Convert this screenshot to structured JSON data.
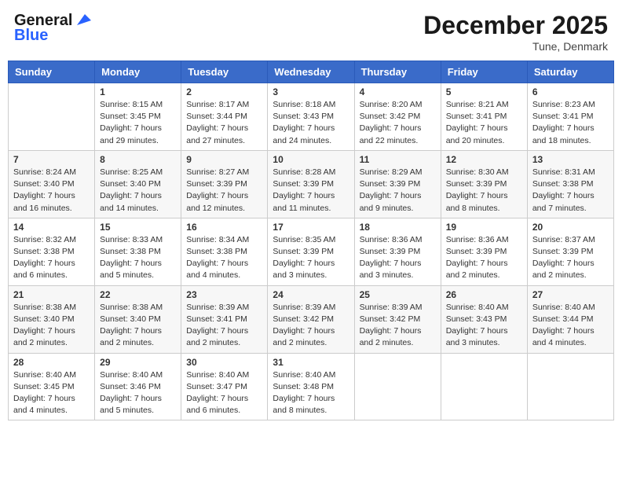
{
  "header": {
    "logo_line1": "General",
    "logo_line2": "Blue",
    "month": "December 2025",
    "location": "Tune, Denmark"
  },
  "days_of_week": [
    "Sunday",
    "Monday",
    "Tuesday",
    "Wednesday",
    "Thursday",
    "Friday",
    "Saturday"
  ],
  "weeks": [
    [
      {
        "day": "",
        "sunrise": "",
        "sunset": "",
        "daylight": ""
      },
      {
        "day": "1",
        "sunrise": "Sunrise: 8:15 AM",
        "sunset": "Sunset: 3:45 PM",
        "daylight": "Daylight: 7 hours and 29 minutes."
      },
      {
        "day": "2",
        "sunrise": "Sunrise: 8:17 AM",
        "sunset": "Sunset: 3:44 PM",
        "daylight": "Daylight: 7 hours and 27 minutes."
      },
      {
        "day": "3",
        "sunrise": "Sunrise: 8:18 AM",
        "sunset": "Sunset: 3:43 PM",
        "daylight": "Daylight: 7 hours and 24 minutes."
      },
      {
        "day": "4",
        "sunrise": "Sunrise: 8:20 AM",
        "sunset": "Sunset: 3:42 PM",
        "daylight": "Daylight: 7 hours and 22 minutes."
      },
      {
        "day": "5",
        "sunrise": "Sunrise: 8:21 AM",
        "sunset": "Sunset: 3:41 PM",
        "daylight": "Daylight: 7 hours and 20 minutes."
      },
      {
        "day": "6",
        "sunrise": "Sunrise: 8:23 AM",
        "sunset": "Sunset: 3:41 PM",
        "daylight": "Daylight: 7 hours and 18 minutes."
      }
    ],
    [
      {
        "day": "7",
        "sunrise": "Sunrise: 8:24 AM",
        "sunset": "Sunset: 3:40 PM",
        "daylight": "Daylight: 7 hours and 16 minutes."
      },
      {
        "day": "8",
        "sunrise": "Sunrise: 8:25 AM",
        "sunset": "Sunset: 3:40 PM",
        "daylight": "Daylight: 7 hours and 14 minutes."
      },
      {
        "day": "9",
        "sunrise": "Sunrise: 8:27 AM",
        "sunset": "Sunset: 3:39 PM",
        "daylight": "Daylight: 7 hours and 12 minutes."
      },
      {
        "day": "10",
        "sunrise": "Sunrise: 8:28 AM",
        "sunset": "Sunset: 3:39 PM",
        "daylight": "Daylight: 7 hours and 11 minutes."
      },
      {
        "day": "11",
        "sunrise": "Sunrise: 8:29 AM",
        "sunset": "Sunset: 3:39 PM",
        "daylight": "Daylight: 7 hours and 9 minutes."
      },
      {
        "day": "12",
        "sunrise": "Sunrise: 8:30 AM",
        "sunset": "Sunset: 3:39 PM",
        "daylight": "Daylight: 7 hours and 8 minutes."
      },
      {
        "day": "13",
        "sunrise": "Sunrise: 8:31 AM",
        "sunset": "Sunset: 3:38 PM",
        "daylight": "Daylight: 7 hours and 7 minutes."
      }
    ],
    [
      {
        "day": "14",
        "sunrise": "Sunrise: 8:32 AM",
        "sunset": "Sunset: 3:38 PM",
        "daylight": "Daylight: 7 hours and 6 minutes."
      },
      {
        "day": "15",
        "sunrise": "Sunrise: 8:33 AM",
        "sunset": "Sunset: 3:38 PM",
        "daylight": "Daylight: 7 hours and 5 minutes."
      },
      {
        "day": "16",
        "sunrise": "Sunrise: 8:34 AM",
        "sunset": "Sunset: 3:38 PM",
        "daylight": "Daylight: 7 hours and 4 minutes."
      },
      {
        "day": "17",
        "sunrise": "Sunrise: 8:35 AM",
        "sunset": "Sunset: 3:39 PM",
        "daylight": "Daylight: 7 hours and 3 minutes."
      },
      {
        "day": "18",
        "sunrise": "Sunrise: 8:36 AM",
        "sunset": "Sunset: 3:39 PM",
        "daylight": "Daylight: 7 hours and 3 minutes."
      },
      {
        "day": "19",
        "sunrise": "Sunrise: 8:36 AM",
        "sunset": "Sunset: 3:39 PM",
        "daylight": "Daylight: 7 hours and 2 minutes."
      },
      {
        "day": "20",
        "sunrise": "Sunrise: 8:37 AM",
        "sunset": "Sunset: 3:39 PM",
        "daylight": "Daylight: 7 hours and 2 minutes."
      }
    ],
    [
      {
        "day": "21",
        "sunrise": "Sunrise: 8:38 AM",
        "sunset": "Sunset: 3:40 PM",
        "daylight": "Daylight: 7 hours and 2 minutes."
      },
      {
        "day": "22",
        "sunrise": "Sunrise: 8:38 AM",
        "sunset": "Sunset: 3:40 PM",
        "daylight": "Daylight: 7 hours and 2 minutes."
      },
      {
        "day": "23",
        "sunrise": "Sunrise: 8:39 AM",
        "sunset": "Sunset: 3:41 PM",
        "daylight": "Daylight: 7 hours and 2 minutes."
      },
      {
        "day": "24",
        "sunrise": "Sunrise: 8:39 AM",
        "sunset": "Sunset: 3:42 PM",
        "daylight": "Daylight: 7 hours and 2 minutes."
      },
      {
        "day": "25",
        "sunrise": "Sunrise: 8:39 AM",
        "sunset": "Sunset: 3:42 PM",
        "daylight": "Daylight: 7 hours and 2 minutes."
      },
      {
        "day": "26",
        "sunrise": "Sunrise: 8:40 AM",
        "sunset": "Sunset: 3:43 PM",
        "daylight": "Daylight: 7 hours and 3 minutes."
      },
      {
        "day": "27",
        "sunrise": "Sunrise: 8:40 AM",
        "sunset": "Sunset: 3:44 PM",
        "daylight": "Daylight: 7 hours and 4 minutes."
      }
    ],
    [
      {
        "day": "28",
        "sunrise": "Sunrise: 8:40 AM",
        "sunset": "Sunset: 3:45 PM",
        "daylight": "Daylight: 7 hours and 4 minutes."
      },
      {
        "day": "29",
        "sunrise": "Sunrise: 8:40 AM",
        "sunset": "Sunset: 3:46 PM",
        "daylight": "Daylight: 7 hours and 5 minutes."
      },
      {
        "day": "30",
        "sunrise": "Sunrise: 8:40 AM",
        "sunset": "Sunset: 3:47 PM",
        "daylight": "Daylight: 7 hours and 6 minutes."
      },
      {
        "day": "31",
        "sunrise": "Sunrise: 8:40 AM",
        "sunset": "Sunset: 3:48 PM",
        "daylight": "Daylight: 7 hours and 8 minutes."
      },
      {
        "day": "",
        "sunrise": "",
        "sunset": "",
        "daylight": ""
      },
      {
        "day": "",
        "sunrise": "",
        "sunset": "",
        "daylight": ""
      },
      {
        "day": "",
        "sunrise": "",
        "sunset": "",
        "daylight": ""
      }
    ]
  ]
}
